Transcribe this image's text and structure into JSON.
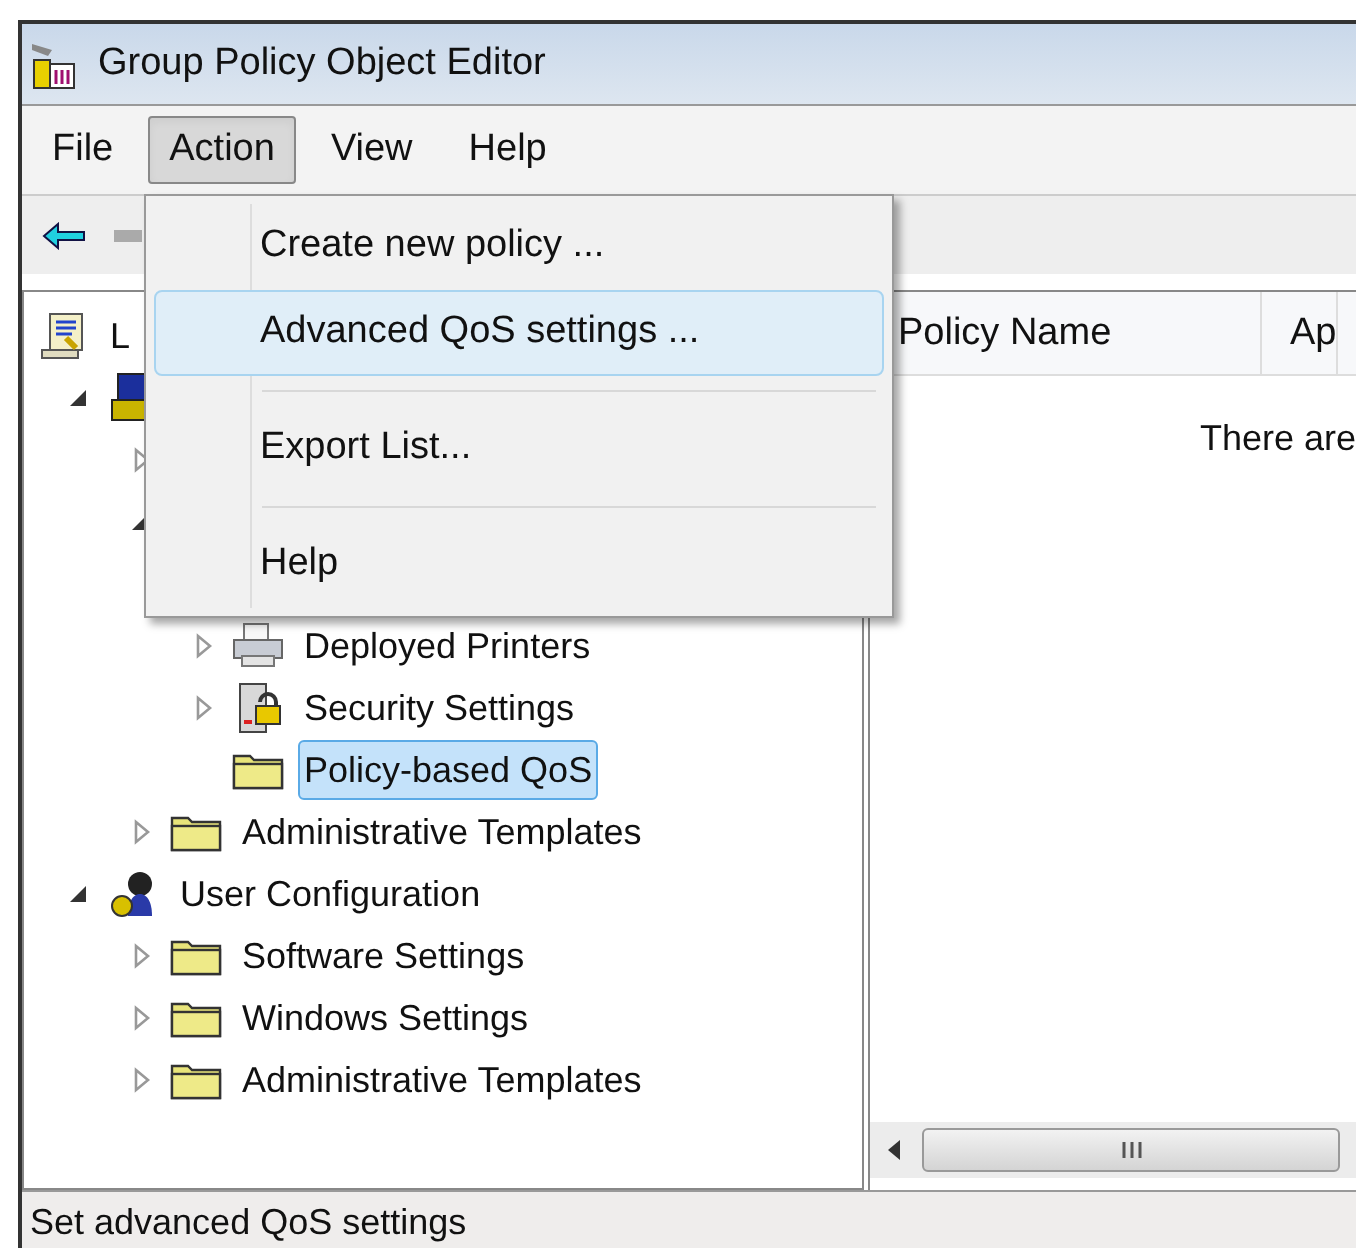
{
  "window": {
    "title": "Group Policy Object Editor"
  },
  "menu_bar": [
    {
      "label": "File",
      "selected": false
    },
    {
      "label": "Action",
      "selected": true
    },
    {
      "label": "View",
      "selected": false
    },
    {
      "label": "Help",
      "selected": false
    }
  ],
  "action_menu": [
    {
      "kind": "item",
      "label": "Create new policy ...",
      "selected": false
    },
    {
      "kind": "item",
      "label": "Advanced QoS settings ...",
      "selected": true
    },
    {
      "kind": "separator"
    },
    {
      "kind": "item",
      "label": "Export List...",
      "selected": false
    },
    {
      "kind": "separator"
    },
    {
      "kind": "item",
      "label": "Help",
      "selected": false
    }
  ],
  "tree": [
    {
      "label": "L",
      "kind": "scroll",
      "selected": false,
      "children": [
        {
          "kind": "computer",
          "expanded": true,
          "children": [
            {
              "expanded": false
            },
            {
              "expanded": true,
              "children": [
                {
                  "kind": "hidden"
                },
                {
                  "label": "Deployed Printers",
                  "kind": "printer",
                  "expanded": false,
                  "selected": false
                },
                {
                  "label": "Security Settings",
                  "kind": "security",
                  "expanded": false,
                  "selected": false
                },
                {
                  "label": "Policy-based QoS",
                  "kind": "folder",
                  "selected": true
                }
              ]
            },
            {
              "label": "Administrative Templates",
              "kind": "folder",
              "expanded": false,
              "selected": false
            }
          ]
        },
        {
          "label": "User Configuration",
          "kind": "user",
          "expanded": true,
          "selected": false,
          "children": [
            {
              "label": "Software Settings",
              "kind": "folder",
              "expanded": false,
              "selected": false
            },
            {
              "label": "Windows Settings",
              "kind": "folder",
              "expanded": false,
              "selected": false
            },
            {
              "label": "Administrative Templates",
              "kind": "folder",
              "expanded": false,
              "selected": false
            }
          ]
        }
      ]
    }
  ],
  "list": {
    "columns": [
      "Policy Name",
      "Ap"
    ],
    "message": "There are"
  },
  "status_bar": "Set advanced QoS settings"
}
